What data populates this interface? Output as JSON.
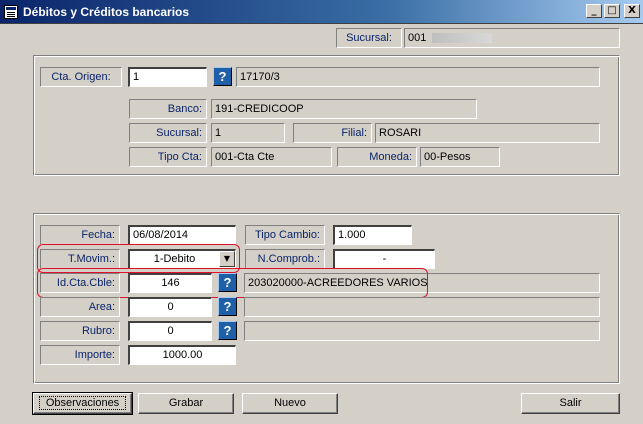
{
  "window": {
    "title": "Débitos y Créditos bancarios",
    "minimize": "_",
    "maximize": "□",
    "close": "X"
  },
  "header": {
    "sucursal_label": "Sucursal:",
    "sucursal_value": "001"
  },
  "origen": {
    "cta_origen_label": "Cta. Origen:",
    "cta_origen_value": "1",
    "cta_origen_desc": "17170/3",
    "banco_label": "Banco:",
    "banco_value": "191-CREDICOOP",
    "sucursal_label": "Sucursal:",
    "sucursal_value": "1",
    "filial_label": "Filial:",
    "filial_value": "ROSARI",
    "tipo_cta_label": "Tipo Cta:",
    "tipo_cta_value": "001-Cta Cte",
    "moneda_label": "Moneda:",
    "moneda_value": "00-Pesos"
  },
  "movimiento": {
    "fecha_label": "Fecha:",
    "fecha_value": "06/08/2014",
    "tipo_cambio_label": "Tipo Cambio:",
    "tipo_cambio_value": "1.000",
    "t_movim_label": "T.Movim.:",
    "t_movim_value": "1-Debito",
    "n_comprob_label": "N.Comprob.:",
    "n_comprob_value": "-",
    "id_cta_label": "Id.Cta.Cble:",
    "id_cta_value": "146",
    "id_cta_desc": "203020000-ACREEDORES VARIOS",
    "area_label": "Area:",
    "area_value": "0",
    "area_desc": "",
    "rubro_label": "Rubro:",
    "rubro_value": "0",
    "rubro_desc": "",
    "importe_label": "Importe:",
    "importe_value": "1000.00"
  },
  "buttons": {
    "help": "?",
    "dropdown": "▼",
    "observaciones": "Observaciones",
    "grabar": "Grabar",
    "nuevo": "Nuevo",
    "salir": "Salir"
  },
  "colors": {
    "title_start": "#0a246a",
    "label_text": "#0a246a",
    "help_button": "#1f5fa8",
    "highlight": "#e0102a"
  }
}
